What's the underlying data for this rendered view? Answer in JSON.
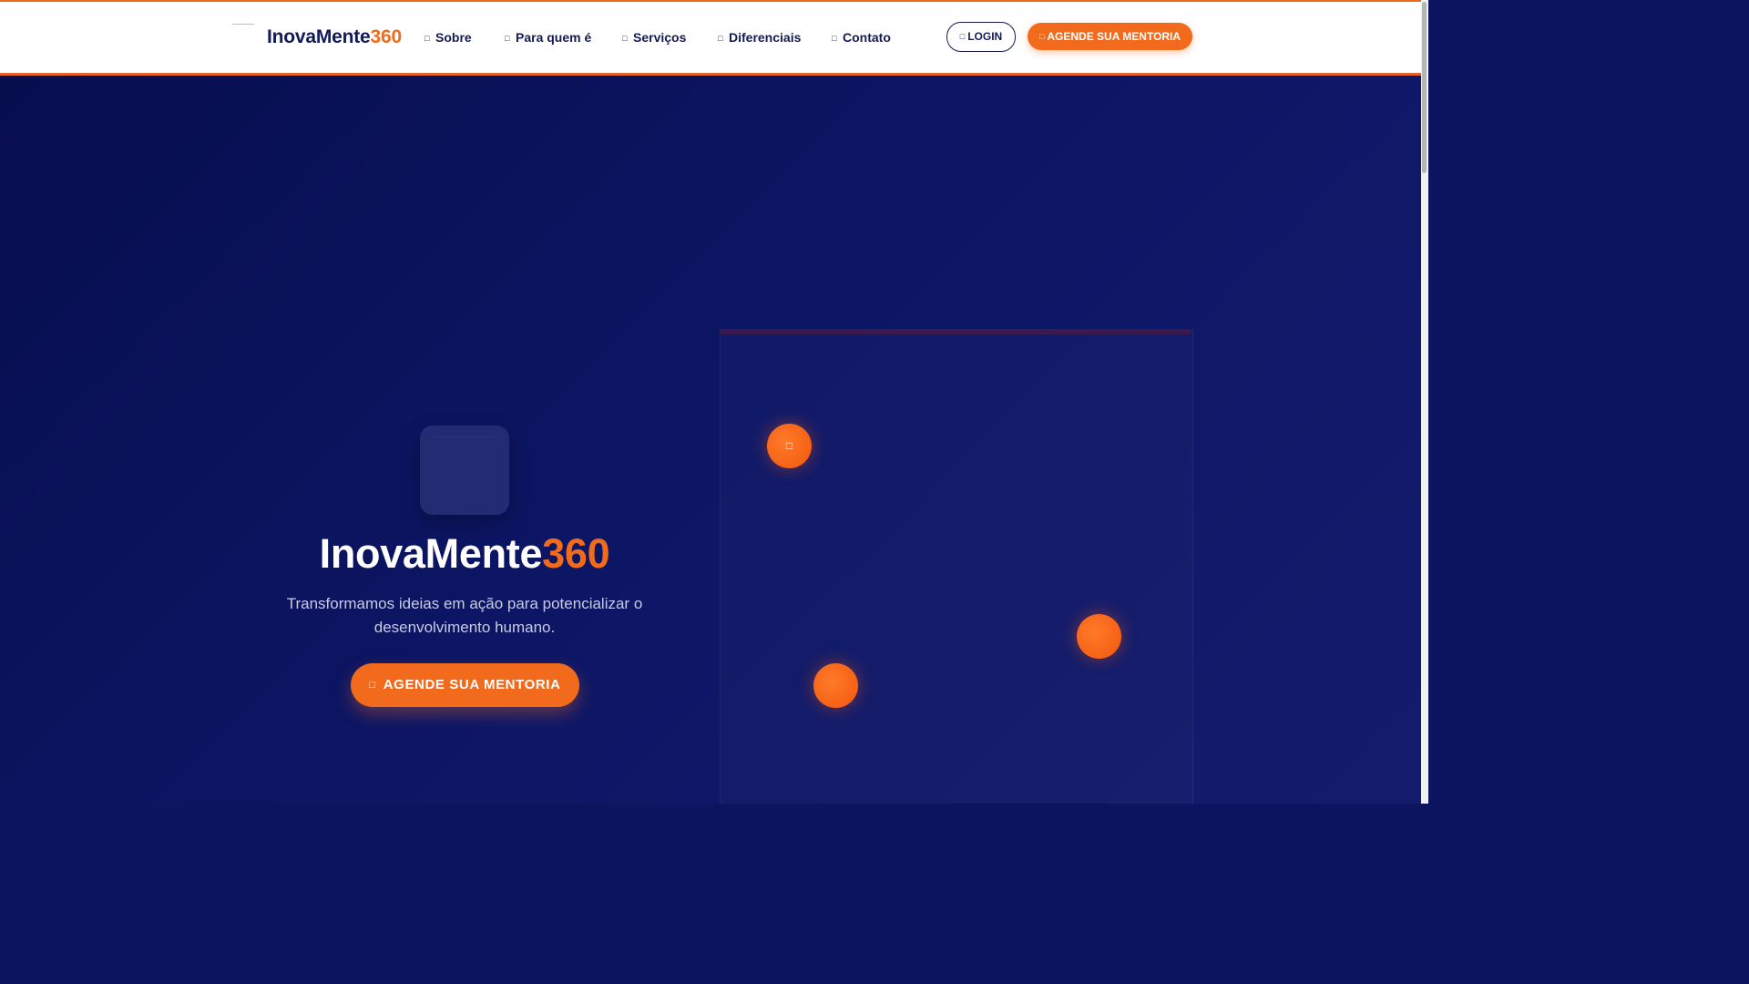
{
  "header": {
    "brand_main": "InovaMente",
    "brand_accent": "360",
    "nav": [
      {
        "label": "Sobre"
      },
      {
        "label": "Para quem é"
      },
      {
        "label": "Serviços"
      },
      {
        "label": "Diferenciais"
      },
      {
        "label": "Contato"
      }
    ],
    "login_label": "LOGIN",
    "cta_label": "AGENDE SUA MENTORIA"
  },
  "hero": {
    "title_main": "InovaMente",
    "title_accent": "360",
    "subtitle": "Transformamos ideias em ação para potencializar o desenvolvimento humano.",
    "cta_label": "AGENDE SUA MENTORIA"
  },
  "colors": {
    "brand_navy": "#131b57",
    "accent_orange": "#f26b1d",
    "hero_bg": "#0c1460"
  },
  "icons": {
    "nav_item_icon": "icon",
    "login_icon": "sign-in-icon",
    "cta_icon": "calendar-icon",
    "feature_dot_icon": "star-icon"
  }
}
